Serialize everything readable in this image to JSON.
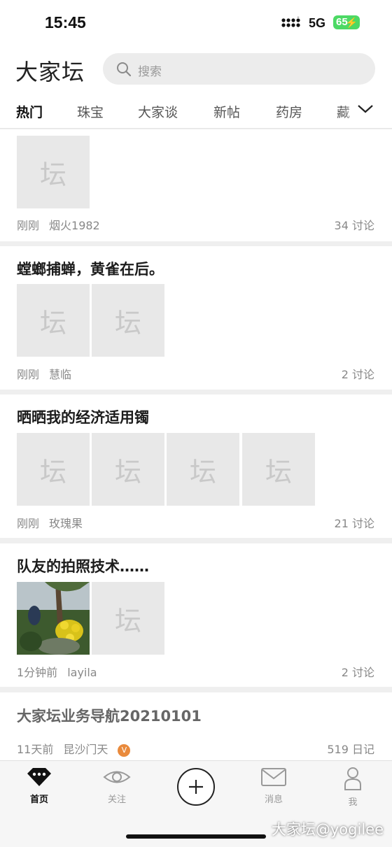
{
  "status": {
    "time": "15:45",
    "network": "5G",
    "battery": "65"
  },
  "header": {
    "logo": "大家坛",
    "search_placeholder": "搜索"
  },
  "tabs": [
    "热门",
    "珠宝",
    "大家谈",
    "新帖",
    "药房",
    "藏"
  ],
  "placeholder_glyph": "坛",
  "posts": [
    {
      "title": "",
      "time": "刚刚",
      "author": "烟火1982",
      "count": "34 讨论"
    },
    {
      "title": "螳螂捕蝉，黄雀在后。",
      "time": "刚刚",
      "author": "慧临",
      "count": "2 讨论"
    },
    {
      "title": "晒晒我的经济适用镯",
      "time": "刚刚",
      "author": "玫瑰果",
      "count": "21 讨论"
    },
    {
      "title": "队友的拍照技术……",
      "time": "1分钟前",
      "author": "layila",
      "count": "2 讨论"
    },
    {
      "title": "大家坛业务导航20210101",
      "time": "11天前",
      "author": "昆沙门天",
      "badge": "V",
      "count": "519 日记"
    }
  ],
  "tabbar": [
    "首页",
    "关注",
    "",
    "消息",
    "我"
  ],
  "watermark": "大家坛@yogilee",
  "colors": {
    "accent": "#e98a3c",
    "battery": "#4cd964"
  }
}
